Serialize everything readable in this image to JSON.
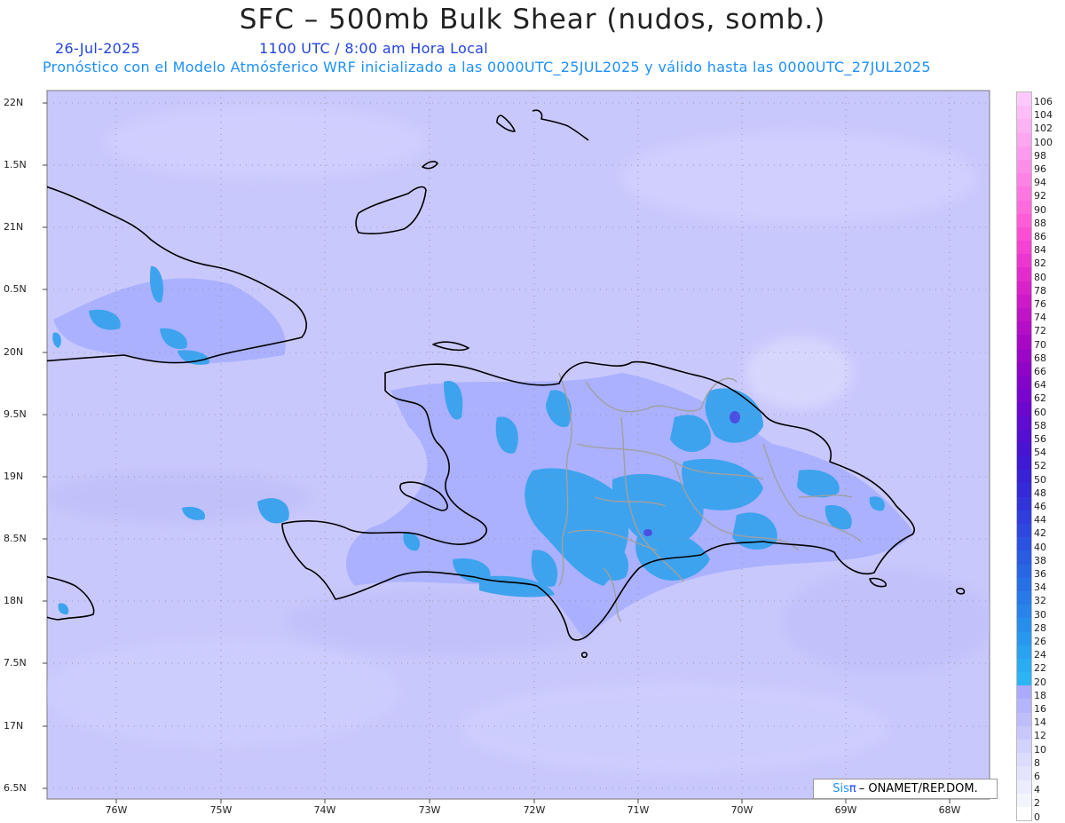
{
  "header": {
    "title": "SFC – 500mb Bulk Shear (nudos, somb.)",
    "date": "26-Jul-2025",
    "time": "1100 UTC / 8:00 am Hora Local",
    "description": "Pronóstico con el Modelo Atmósferico WRF inicializado a las 0000UTC_25JUL2025 y válido hasta las  0000UTC_27JUL2025"
  },
  "axes": {
    "lat_labels": [
      "22N",
      "1.5N",
      "21N",
      "0.5N",
      "20N",
      "9.5N",
      "19N",
      "8.5N",
      "18N",
      "7.5N",
      "17N",
      "6.5N"
    ],
    "lon_labels": [
      "76W",
      "75W",
      "74W",
      "73W",
      "72W",
      "71W",
      "70W",
      "69W",
      "68W"
    ]
  },
  "colorbar": {
    "labels": [
      "106",
      "104",
      "102",
      "100",
      "98",
      "96",
      "94",
      "92",
      "90",
      "88",
      "86",
      "84",
      "82",
      "80",
      "78",
      "76",
      "74",
      "72",
      "70",
      "68",
      "66",
      "64",
      "62",
      "60",
      "58",
      "56",
      "54",
      "52",
      "50",
      "48",
      "46",
      "44",
      "42",
      "40",
      "38",
      "36",
      "34",
      "32",
      "30",
      "28",
      "26",
      "24",
      "22",
      "20",
      "18",
      "16",
      "14",
      "12",
      "10",
      "8",
      "6",
      "4",
      "2",
      "0"
    ],
    "colors": [
      "#ffc8ff",
      "#ffbef8",
      "#ffb2f4",
      "#ffa6f0",
      "#ff9aec",
      "#ff8ee8",
      "#ff82e4",
      "#ff76e0",
      "#ff6adc",
      "#ff5cd8",
      "#fc4ed4",
      "#f442d2",
      "#ec36d0",
      "#e22ccc",
      "#d822ca",
      "#cc1ac8",
      "#c014c6",
      "#b40ec6",
      "#a808c6",
      "#9c06c6",
      "#9004c8",
      "#8404ca",
      "#7806cc",
      "#6c08ce",
      "#600cd0",
      "#5410d0",
      "#4814d2",
      "#3e1ad4",
      "#3822d6",
      "#342ad8",
      "#3234da",
      "#303edc",
      "#2e48de",
      "#2c52e0",
      "#2a5ce2",
      "#2866e4",
      "#2870e6",
      "#287ae8",
      "#2884ea",
      "#288eec",
      "#2898ee",
      "#2aa2f0",
      "#2aacf2",
      "#2cb4f4",
      "#aaaaff",
      "#b4b4ff",
      "#bebeff",
      "#c8c8ff",
      "#d2d2ff",
      "#dcdcff",
      "#e4e4ff",
      "#ececff",
      "#f4f4ff",
      "#ffffff"
    ]
  },
  "credit": {
    "logo": "Sis",
    "pi": "π",
    "text": "– ONAMET/REP.DOM."
  },
  "colors": {
    "background_shear": "#c8c8ff",
    "moderate_shear": "#a0a8ff",
    "strong_shear": "#3ea6ee",
    "coastline": "#000000",
    "province_borders": "#a0a0a0",
    "grid": "#888888"
  }
}
